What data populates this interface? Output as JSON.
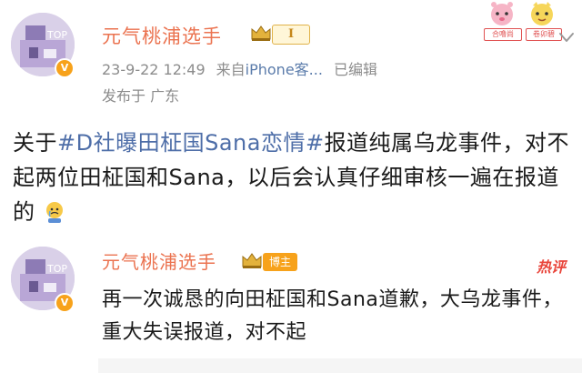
{
  "post": {
    "username": "元气桃浦选手",
    "level_badge": "I",
    "timestamp": "23-9-22 12:49",
    "source_prefix": "来自",
    "source_device": "iPhone客...",
    "edited": "已编辑",
    "location": "发布于 广东",
    "verified_mark": "V",
    "text_prefix": "关于",
    "hashtag": "#D社曝田柾国Sana恋情#",
    "text_body": "报道纯属乌龙事件，对不起两位田柾国和Sana，以后会认真仔细审核一遍在报道的",
    "emoji": "sad-face-emoji"
  },
  "stickers": [
    {
      "label": "合噜尚",
      "icon": "pink-character-sticker"
    },
    {
      "label": "卷卯碧",
      "icon": "yellow-character-sticker"
    }
  ],
  "comment": {
    "username": "元气桃浦选手",
    "author_badge": "博主",
    "hot_label": "热评",
    "verified_mark": "V",
    "text": "再一次诚恳的向田柾国和Sana道歉，大乌龙事件，重大失误报道，对不起"
  },
  "colors": {
    "username": "#eb7350",
    "hashtag": "#4e6ea8",
    "meta": "#8c8c8c",
    "badge_orange": "#f7a21b",
    "hot": "#e9453b"
  }
}
